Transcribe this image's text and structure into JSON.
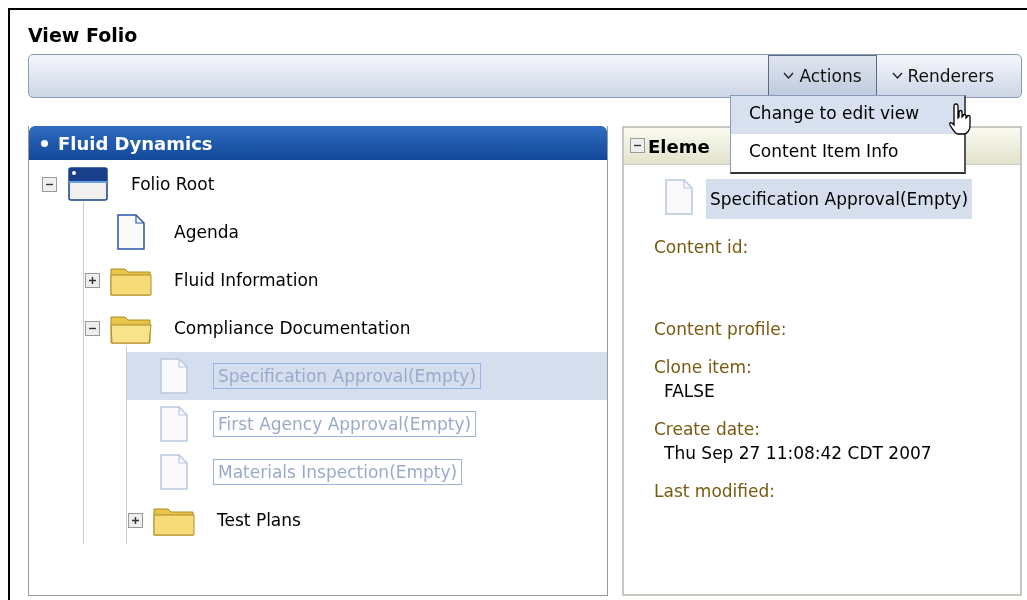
{
  "title": "View Folio",
  "toolbar": {
    "buttons": [
      {
        "label": "Actions",
        "pressed": true
      },
      {
        "label": "Renderers",
        "pressed": false
      }
    ]
  },
  "menu": {
    "items": [
      {
        "label": "Change to edit view",
        "selected": true
      },
      {
        "label": "Content Item Info",
        "selected": false
      }
    ]
  },
  "tree_panel": {
    "title": "Fluid Dynamics",
    "tree": [
      {
        "label": "Folio Root",
        "kind": "root",
        "expanded": true,
        "empty": false,
        "selected": false,
        "children": [
          {
            "label": "Agenda",
            "kind": "document",
            "empty": false,
            "selected": false
          },
          {
            "label": "Fluid Information",
            "kind": "folder",
            "expanded": false,
            "empty": false,
            "selected": false
          },
          {
            "label": "Compliance Documentation",
            "kind": "folder",
            "expanded": true,
            "empty": false,
            "selected": false,
            "children": [
              {
                "label": "Specification Approval(Empty)",
                "kind": "document",
                "empty": true,
                "selected": true
              },
              {
                "label": "First Agency Approval(Empty)",
                "kind": "document",
                "empty": true,
                "selected": false
              },
              {
                "label": "Materials Inspection(Empty)",
                "kind": "document",
                "empty": true,
                "selected": false
              },
              {
                "label": "Test Plans",
                "kind": "folder",
                "expanded": false,
                "empty": false,
                "selected": false
              }
            ]
          }
        ]
      }
    ]
  },
  "detail_panel": {
    "title": "Eleme",
    "expanded": true,
    "item": "Specification Approval(Empty)",
    "fields": [
      {
        "label": "Content id:"
      },
      {
        "label": "Content profile:"
      },
      {
        "label": "Clone item:",
        "value": "FALSE"
      },
      {
        "label": "Create date:",
        "value": "Thu Sep 27 11:08:42 CDT 2007"
      },
      {
        "label": "Last modified:"
      }
    ]
  }
}
